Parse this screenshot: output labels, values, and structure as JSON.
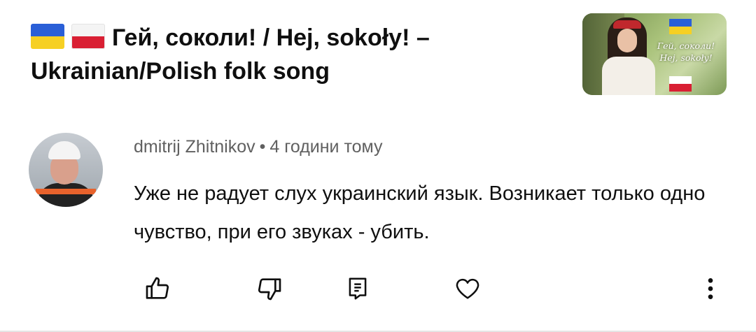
{
  "video": {
    "title_line1": "Гей, соколи! / Hej, sokoły! –",
    "title_line2": "Ukrainian/Polish folk song",
    "thumbnail_text_line1": "Гей, соколи!",
    "thumbnail_text_line2": "Hej, sokoły!"
  },
  "comment": {
    "author": "dmitrij Zhitnikov",
    "separator": "•",
    "time": "4 години тому",
    "text": "Уже не радует слух украинский язык. Возникает только одно чувство, при его звуках - убить."
  },
  "actions": [
    {
      "icon": "thumbs-up-icon"
    },
    {
      "icon": "thumbs-down-icon"
    },
    {
      "icon": "reply-icon"
    },
    {
      "icon": "heart-icon"
    },
    {
      "icon": "more-vert-icon"
    }
  ],
  "colors": {
    "text": "#0f0f0f",
    "secondary_text": "#606060",
    "flag_blue": "#2a5fd7",
    "flag_yellow": "#f6d023",
    "flag_red": "#d91f33"
  }
}
